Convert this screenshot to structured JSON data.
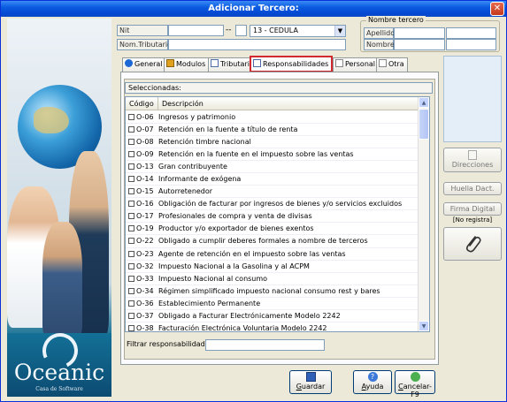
{
  "window": {
    "title": "Adicionar Tercero:",
    "close_glyph": "✕"
  },
  "ident": {
    "nit_label": "Nit",
    "nit_value": "",
    "dash": "--",
    "doc_type": "13 - CEDULA",
    "nom_tributario_label": "Nom.Tributario",
    "nom_tributario_value": ""
  },
  "nombre_tercero": {
    "legend": "Nombre tercero",
    "apellidos_label": "Apellidos",
    "nombres_label": "Nombres"
  },
  "tabs": [
    {
      "label": "General",
      "icon": "info-icon",
      "active": false
    },
    {
      "label": "Modulos",
      "icon": "grid-icon",
      "active": false
    },
    {
      "label": "Tributaria",
      "icon": "table-icon",
      "active": false
    },
    {
      "label": "Responsabilidades",
      "icon": "table-icon",
      "active": true
    },
    {
      "label": "Personal",
      "icon": "page-icon",
      "active": false
    },
    {
      "label": "Otra",
      "icon": "page-icon",
      "active": false
    }
  ],
  "responsabilidades": {
    "seleccionadas_label": "Seleccionadas:",
    "columns": [
      "Código",
      "Descripción"
    ],
    "rows": [
      {
        "code": "O-06",
        "desc": "Ingresos y patrimonio"
      },
      {
        "code": "O-07",
        "desc": "Retención en la fuente a título de renta"
      },
      {
        "code": "O-08",
        "desc": "Retención timbre nacional"
      },
      {
        "code": "O-09",
        "desc": "Retención en la fuente en el impuesto sobre las ventas"
      },
      {
        "code": "O-13",
        "desc": "Gran contribuyente"
      },
      {
        "code": "O-14",
        "desc": "Informante de exógena"
      },
      {
        "code": "O-15",
        "desc": "Autorretenedor"
      },
      {
        "code": "O-16",
        "desc": "Obligación de facturar por ingresos de bienes y/o servicios excluidos"
      },
      {
        "code": "O-17",
        "desc": "Profesionales de compra y venta de divisas"
      },
      {
        "code": "O-19",
        "desc": "Productor y/o exportador de bienes exentos"
      },
      {
        "code": "O-22",
        "desc": "Obligado a cumplir deberes formales a nombre de terceros"
      },
      {
        "code": "O-23",
        "desc": "Agente de retención en el impuesto sobre las ventas"
      },
      {
        "code": "O-32",
        "desc": "Impuesto Nacional a la Gasolina y al ACPM"
      },
      {
        "code": "O-33",
        "desc": "Impuesto Nacional al consumo"
      },
      {
        "code": "O-34",
        "desc": "Régimen simplificado impuesto nacional consumo rest y bares"
      },
      {
        "code": "O-36",
        "desc": "Establecimiento Permanente"
      },
      {
        "code": "O-37",
        "desc": "Obligado a Facturar Electrónicamente Modelo 2242"
      },
      {
        "code": "O-38",
        "desc": "Facturación Electrónica Voluntaria Modelo 2242"
      }
    ],
    "filter_label": "Filtrar responsabilidades",
    "filter_value": ""
  },
  "side": {
    "direcciones_label": "Direcciones",
    "huella_label": "Huella Dact.",
    "firma_label": "Firma Digital",
    "no_registra": "[No registra]"
  },
  "buttons": {
    "guardar": "Guardar",
    "ayuda": "Ayuda",
    "cancelar": "Cancelar-F9"
  },
  "branding": {
    "name": "Oceanic",
    "sub": "Casa de Software"
  }
}
